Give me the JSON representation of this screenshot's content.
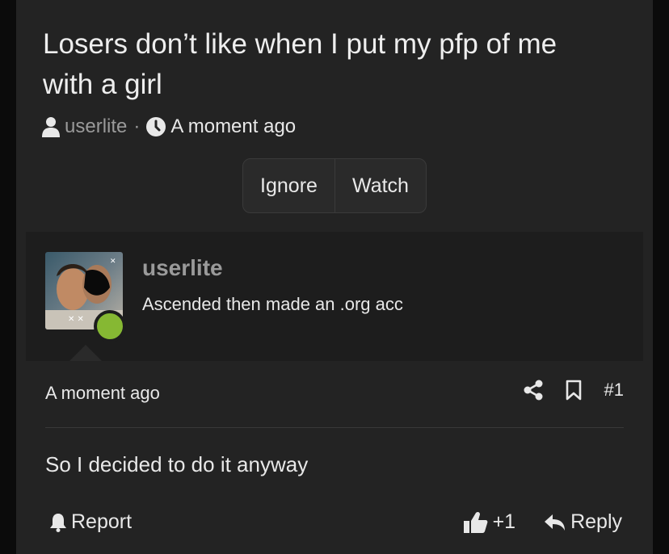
{
  "thread": {
    "title": "Losers don’t like when I put my pfp of me with a girl",
    "author": "userlite",
    "separator": "·",
    "time": "A moment ago"
  },
  "thread_actions": {
    "ignore_label": "Ignore",
    "watch_label": "Watch"
  },
  "post": {
    "username": "userlite",
    "user_title": "Ascended then made an .org acc",
    "time": "A moment ago",
    "post_number": "#1",
    "body": "So I decided to do it anyway",
    "report_label": "Report",
    "reaction_count": "+1",
    "reply_label": "Reply",
    "online_status_color": "#86b833"
  },
  "icons": {
    "author": "user-icon",
    "time": "clock-icon",
    "share": "share-icon",
    "bookmark": "bookmark-icon",
    "report": "bell-icon",
    "reaction": "thumbs-up-icon",
    "reply": "reply-icon"
  }
}
